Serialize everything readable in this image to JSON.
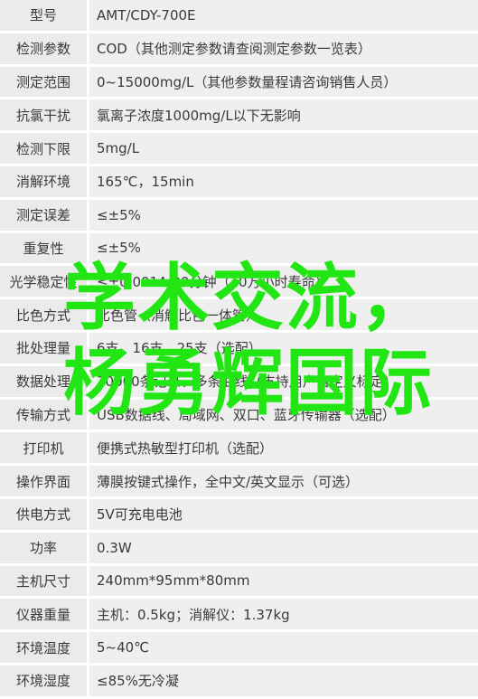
{
  "specs": [
    {
      "label": "型号",
      "value": "AMT/CDY-700E"
    },
    {
      "label": "检测参数",
      "value": "COD（其他测定参数请查阅测定参数一览表）"
    },
    {
      "label": "测定范围",
      "value": "0~15000mg/L（其他参数量程请咨询销售人员）"
    },
    {
      "label": "抗氯干扰",
      "value": "氯离子浓度1000mg/L以下无影响"
    },
    {
      "label": "检测下限",
      "value": "5mg/L"
    },
    {
      "label": "消解环境",
      "value": "165℃，15min"
    },
    {
      "label": "测定误差",
      "value": "≤±5%"
    },
    {
      "label": "重复性",
      "value": "≤±5%"
    },
    {
      "label": "光学稳定性",
      "value": "≤±0.001A/20分钟（10万小时寿命）"
    },
    {
      "label": "比色方式",
      "value": "比色管（消解比色一体管）"
    },
    {
      "label": "批处理量",
      "value": "6支、16支、25支（选配）"
    },
    {
      "label": "数据处理",
      "value": "30000条记录、多条曲线（支持用户自定义标定）"
    },
    {
      "label": "传输方式",
      "value": "USB数据线、局域网、双口、蓝牙传输器（选配）"
    },
    {
      "label": "打印机",
      "value": "便携式热敏型打印机（选配）"
    },
    {
      "label": "操作界面",
      "value": "薄膜按键式操作，全中文/英文显示（可选）"
    },
    {
      "label": "供电方式",
      "value": "5V可充电电池"
    },
    {
      "label": "功率",
      "value": "0.3W"
    },
    {
      "label": "主机尺寸",
      "value": "240mm*95mm*80mm"
    },
    {
      "label": "仪器重量",
      "value": "主机：0.5kg；消解仪：1.37kg"
    },
    {
      "label": "环境温度",
      "value": "5~40℃"
    },
    {
      "label": "环境湿度",
      "value": "≤85%无冷凝"
    }
  ],
  "watermark": {
    "line1": "学术交流，",
    "line2": "杨勇辉国际",
    "color": "#22e614"
  }
}
